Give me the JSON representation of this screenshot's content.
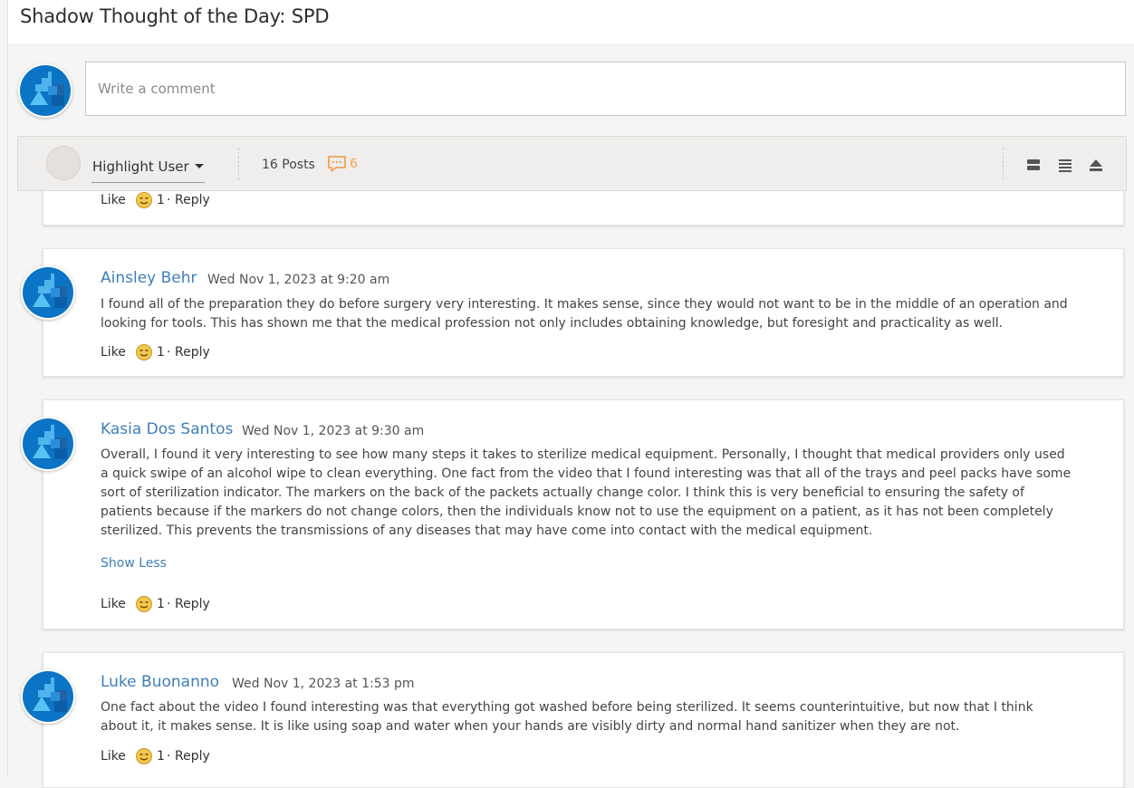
{
  "page": {
    "title": "Shadow Thought of the Day: SPD"
  },
  "composer": {
    "placeholder": "Write a comment"
  },
  "toolbar": {
    "highlight_label": "Highlight User",
    "posts_label": "16 Posts",
    "comment_count": "6",
    "accent": "#f0a35a",
    "view_icons": [
      "card-view-icon",
      "list-view-icon",
      "collapse-icon"
    ]
  },
  "colors": {
    "author": "#3f7fb8",
    "avatar": "#0c74c4",
    "toolbar_bg": "#efeeec"
  },
  "actions": {
    "like": "Like",
    "reply": "Reply",
    "separator": "·",
    "emoji_icon": "smiley-icon"
  },
  "posts": [
    {
      "likes": "1"
    },
    {
      "author": "Ainsley Behr",
      "timestamp": "Wed Nov 1, 2023 at 9:20 am",
      "body": "I found all of the preparation they do before surgery very interesting. It makes sense, since they would not want to be in the middle of an operation and looking for tools. This has shown me that the medical profession not only includes obtaining knowledge, but foresight and practicality as well.",
      "likes": "1"
    },
    {
      "author": "Kasia Dos Santos",
      "timestamp": "Wed Nov 1, 2023 at 9:30 am",
      "body": "Overall, I found it very interesting to see how many steps it takes to sterilize medical equipment. Personally, I thought that medical providers only used a quick swipe of an alcohol wipe to clean everything. One fact from the video that I found interesting was that all of the trays and peel packs have some sort of sterilization indicator. The markers on the back of the packets actually change color. I think this is very beneficial to ensuring the safety of patients because if the markers do not change colors, then the individuals know not to use the equipment on a patient, as it has not been completely sterilized. This prevents the transmissions of any diseases that may have come into contact with the medical equipment.",
      "toggle": "Show Less",
      "likes": "1"
    },
    {
      "author": "Luke Buonanno",
      "timestamp": "Wed Nov 1, 2023 at 1:53 pm",
      "body": "One fact about the video I found interesting was that everything got washed before being sterilized. It seems counterintuitive, but now that I think about it, it makes sense. It is like using soap and water when your hands are visibly dirty and normal hand sanitizer when they are not.",
      "likes": "1"
    }
  ]
}
